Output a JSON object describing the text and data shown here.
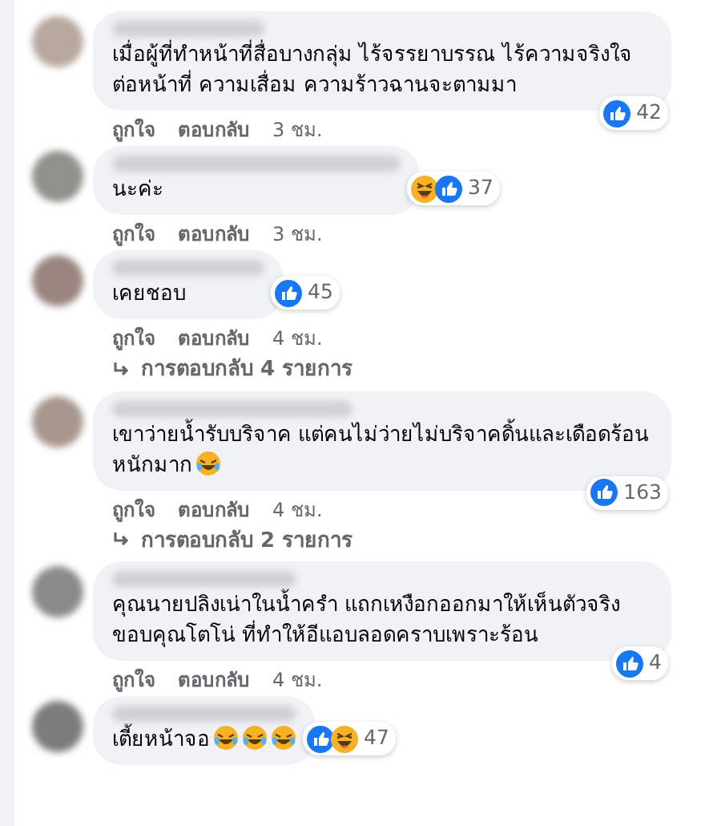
{
  "comments": [
    {
      "kind": "wide",
      "text": "เมื่อผู้ที่ทำหน้าที่สื่อบางกลุ่ม ไร้จรรยาบรรณ ไร้ความจริงใจต่อหน้าที่ ความเสื่อม ความร้าวฉานจะตามมา",
      "reactions": [
        {
          "kind": "like"
        }
      ],
      "count": "42",
      "like": "ถูกใจ",
      "reply": "ตอบกลับ",
      "time": "3 ชม."
    },
    {
      "kind": "short",
      "text": "นะค่ะ",
      "reactions": [
        {
          "kind": "haha"
        },
        {
          "kind": "like"
        }
      ],
      "count": "37",
      "like": "ถูกใจ",
      "reply": "ตอบกลับ",
      "time": "3 ชม."
    },
    {
      "kind": "short",
      "text": "เคยชอบ",
      "reactions": [
        {
          "kind": "like"
        }
      ],
      "count": "45",
      "like": "ถูกใจ",
      "reply": "ตอบกลับ",
      "time": "4 ชม.",
      "replies": "การตอบกลับ 4 รายการ"
    },
    {
      "kind": "wide",
      "text": "เขาว่ายน้ำรับบริจาค แต่คนไม่ว่ายไม่บริจาคดิ้นและเดือดร้อนหนักมาก",
      "emojis": [
        {
          "kind": "laugh"
        }
      ],
      "reactions": [
        {
          "kind": "like"
        }
      ],
      "count": "163",
      "like": "ถูกใจ",
      "reply": "ตอบกลับ",
      "time": "4 ชม.",
      "replies": "การตอบกลับ 2 รายการ"
    },
    {
      "kind": "wide",
      "text": "คุณนายปลิงเน่าในน้ำครำ แถกเหงือกออกมาให้เห็นตัวจริง ขอบคุณโตโน่ ที่ทำให้อีแอบลอดคราบเพราะร้อน",
      "reactions": [
        {
          "kind": "like"
        }
      ],
      "count": "4",
      "like": "ถูกใจ",
      "reply": "ตอบกลับ",
      "time": "4 ชม."
    },
    {
      "kind": "short",
      "text": "เตี้ยหน้าจอ",
      "emojis": [
        {
          "kind": "laugh"
        },
        {
          "kind": "laugh"
        },
        {
          "kind": "laugh"
        }
      ],
      "reactions": [
        {
          "kind": "like"
        },
        {
          "kind": "haha"
        }
      ],
      "count": "47"
    }
  ]
}
